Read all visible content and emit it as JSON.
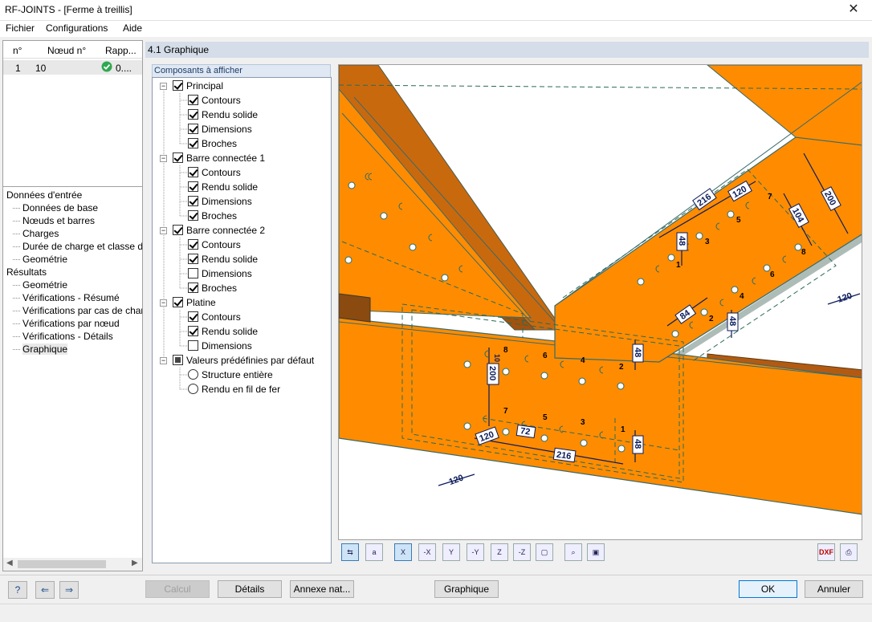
{
  "window": {
    "title": "RF-JOINTS - [Ferme à treillis]",
    "close": "✕"
  },
  "menu": [
    "Fichier",
    "Configurations",
    "Aide"
  ],
  "nodes_table": {
    "headers": [
      "n°",
      "Nœud n°",
      "Rapp..."
    ],
    "rows": [
      {
        "n": "1",
        "node": "10",
        "ratio": "0...."
      }
    ]
  },
  "nav": {
    "input_title": "Données d'entrée",
    "input_items": [
      "Données de base",
      "Nœuds et barres",
      "Charges",
      "Durée de charge et classe de s",
      "Geométrie"
    ],
    "results_title": "Résultats",
    "results_items": [
      "Geométrie",
      "Vérifications - Résumé",
      "Vérifications par cas de charge",
      "Vérifications par nœud",
      "Vérifications - Détails",
      "Graphique"
    ]
  },
  "section_title": "4.1 Graphique",
  "components_tab": "Composants à afficher",
  "tree": {
    "principal": {
      "label": "Principal",
      "items": [
        "Contours",
        "Rendu solide",
        "Dimensions",
        "Broches"
      ],
      "checked": [
        true,
        true,
        true,
        true
      ]
    },
    "bc1": {
      "label": "Barre connectée 1",
      "items": [
        "Contours",
        "Rendu solide",
        "Dimensions",
        "Broches"
      ],
      "checked": [
        true,
        true,
        true,
        true
      ]
    },
    "bc2": {
      "label": "Barre connectée 2",
      "items": [
        "Contours",
        "Rendu solide",
        "Dimensions",
        "Broches"
      ],
      "checked": [
        true,
        true,
        false,
        true
      ]
    },
    "platine": {
      "label": "Platine",
      "items": [
        "Contours",
        "Rendu solide",
        "Dimensions"
      ],
      "checked": [
        true,
        true,
        false
      ]
    },
    "defaults": {
      "label": "Valeurs prédéfinies par défaut",
      "items": [
        "Structure entière",
        "Rendu en fil de fer"
      ]
    }
  },
  "dims": {
    "d216": "216",
    "d120": "120",
    "d200": "200",
    "d104": "104",
    "d48": "48",
    "d84": "84",
    "d72": "72",
    "d10": "10"
  },
  "pins_a": [
    "1",
    "2",
    "3",
    "4",
    "5",
    "6",
    "7",
    "8"
  ],
  "toolbar_icons": [
    "view-x-icon",
    "view-a-icon",
    "axis-x-icon",
    "axis-neg-x-icon",
    "axis-y-icon",
    "axis-neg-y-icon",
    "axis-z-icon",
    "axis-neg-z-icon",
    "iso-view-icon",
    "zoom-icon",
    "layers-icon",
    "dxf-export-icon",
    "print-icon"
  ],
  "toolbar_text": {
    "x": "X",
    "negx": "-X",
    "y": "Y",
    "negy": "-Y",
    "z": "Z",
    "negz": "-Z",
    "dxf": "DXF"
  },
  "buttons": {
    "calcul": "Calcul",
    "details": "Détails",
    "annexe": "Annexe nat...",
    "graphique": "Graphique",
    "ok": "OK",
    "annuler": "Annuler"
  },
  "colors": {
    "steel": "#ff8c00",
    "steel_dark": "#c0600a",
    "plate": "#f7941d",
    "accent": "#0078d7"
  }
}
